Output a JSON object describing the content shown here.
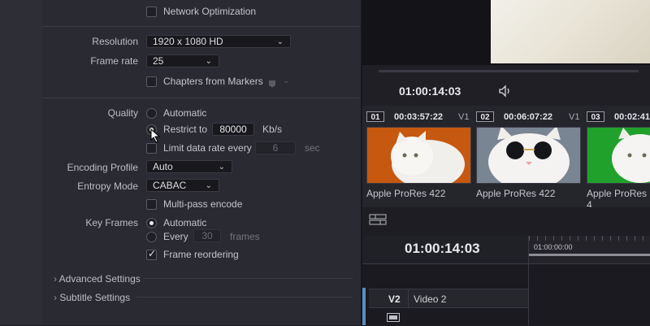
{
  "export": {
    "network_optimization": "Network Optimization",
    "resolution_label": "Resolution",
    "resolution_value": "1920 x 1080 HD",
    "frame_rate_label": "Frame rate",
    "frame_rate_value": "25",
    "chapters_label": "Chapters from Markers",
    "quality_label": "Quality",
    "quality_automatic": "Automatic",
    "quality_restrict": "Restrict to",
    "bitrate_value": "80000",
    "bitrate_unit": "Kb/s",
    "limit_data_rate": "Limit data rate every",
    "limit_seconds": "6",
    "limit_unit": "sec",
    "encoding_profile_label": "Encoding Profile",
    "encoding_profile_value": "Auto",
    "entropy_mode_label": "Entropy Mode",
    "entropy_mode_value": "CABAC",
    "multipass_label": "Multi-pass encode",
    "key_frames_label": "Key Frames",
    "key_frames_automatic": "Automatic",
    "key_frames_every": "Every",
    "key_frames_count": "30",
    "key_frames_unit": "frames",
    "frame_reordering": "Frame reordering",
    "advanced_settings": "Advanced Settings",
    "subtitle_settings": "Subtitle Settings"
  },
  "viewer": {
    "timecode": "01:00:14:03"
  },
  "clips": [
    {
      "index": "01",
      "timecode": "00:03:57:22",
      "track": "V1",
      "name": "Apple ProRes 422",
      "bg": "#c8590f"
    },
    {
      "index": "02",
      "timecode": "00:06:07:22",
      "track": "V1",
      "name": "Apple ProRes 422",
      "bg": "#6f7a86"
    },
    {
      "index": "03",
      "timecode": "00:02:41",
      "track": "",
      "name": "Apple ProRes 4",
      "bg": "#1f9a2a"
    }
  ],
  "timeline": {
    "timecode": "01:00:14:03",
    "ruler_start": "01:00:00:00",
    "track_id": "V2",
    "track_name": "Video 2"
  }
}
